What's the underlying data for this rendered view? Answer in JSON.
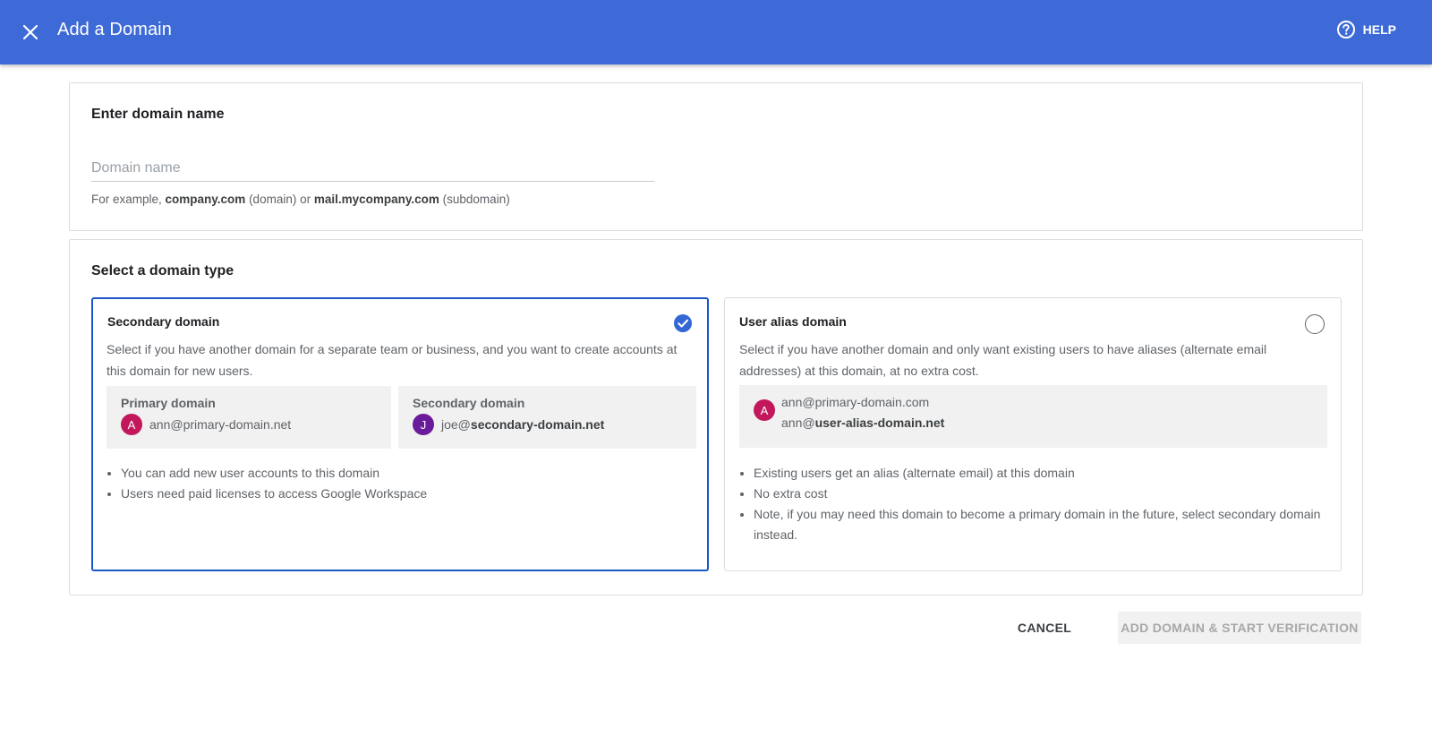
{
  "header": {
    "title": "Add a Domain",
    "help_label": "HELP",
    "bg_color": "#3d6ad6"
  },
  "domain_name": {
    "title": "Enter domain name",
    "placeholder": "Domain name",
    "value": "",
    "hint_prefix": "For example, ",
    "hint_domain": "company.com",
    "hint_mid": " (domain) or ",
    "hint_subdomain": "mail.mycompany.com",
    "hint_suffix": " (subdomain)"
  },
  "domain_type": {
    "title": "Select a domain type",
    "secondary": {
      "title": "Secondary domain",
      "selected": true,
      "description": "Select if you have another domain for a separate team or business, and you want to create accounts at this domain for new users.",
      "primary_label": "Primary domain",
      "primary_avatar": "A",
      "primary_email": "ann@primary-domain.net",
      "secondary_label": "Secondary domain",
      "secondary_avatar": "J",
      "secondary_email_user": "joe@",
      "secondary_email_domain": "secondary-domain.net",
      "bullets": [
        "You can add new user accounts to this domain",
        "Users need paid licenses to access Google Workspace"
      ]
    },
    "alias": {
      "title": "User alias domain",
      "selected": false,
      "description": "Select if you have another domain and only want existing users to have aliases (alternate email addresses) at this domain, at no extra cost.",
      "avatar": "A",
      "email_primary": "ann@primary-domain.com",
      "email_alias_user": "ann@",
      "email_alias_domain": "user-alias-domain.net",
      "bullets": [
        "Existing users get an alias (alternate email) at this domain",
        "No extra cost",
        "Note, if you may need this domain to become a primary domain in the future, select secondary domain instead."
      ]
    }
  },
  "actions": {
    "cancel_label": "CANCEL",
    "add_label": "ADD DOMAIN & START VERIFICATION",
    "add_enabled": false
  }
}
